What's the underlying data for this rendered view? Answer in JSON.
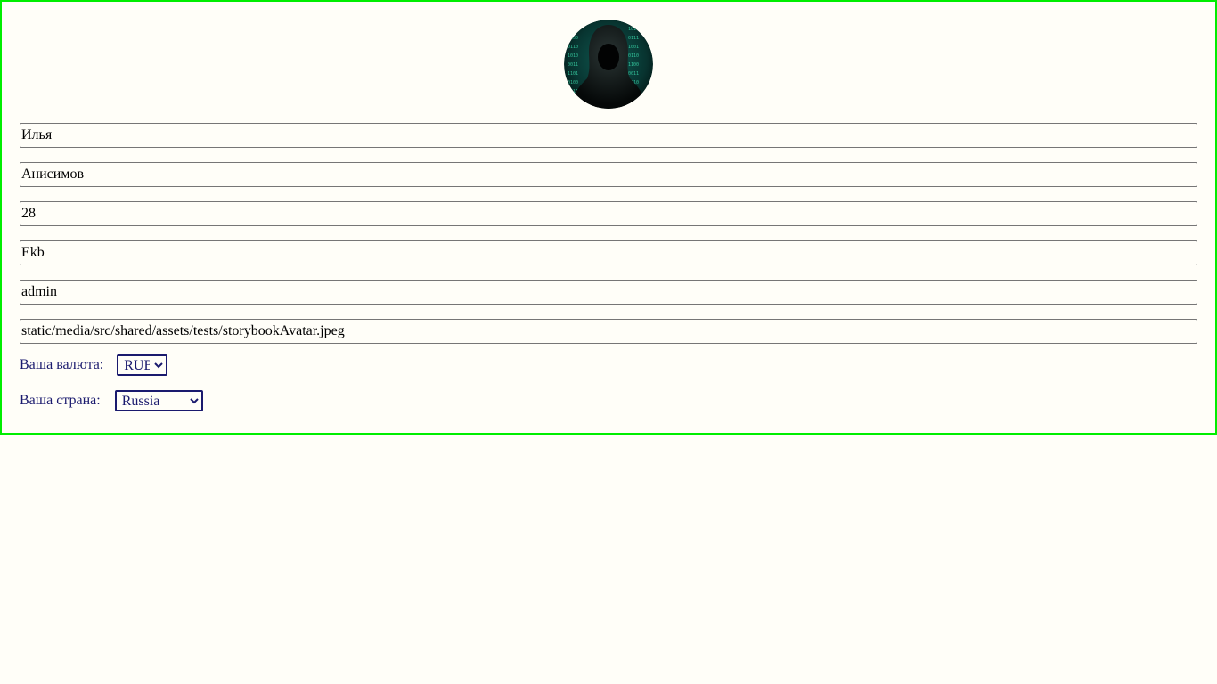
{
  "profile": {
    "avatar_icon": "hooded-hacker-avatar",
    "first_name": "Илья",
    "last_name": "Анисимов",
    "age": "28",
    "city": "Ekb",
    "username": "admin",
    "avatar_url": "static/media/src/shared/assets/tests/storybookAvatar.jpeg"
  },
  "currency": {
    "label": "Ваша валюта:",
    "selected": "RUB"
  },
  "country": {
    "label": "Ваша страна:",
    "selected": "Russia"
  },
  "colors": {
    "card_border": "#00ee00",
    "label_text": "#1a1a6e",
    "background": "#fffef8"
  }
}
